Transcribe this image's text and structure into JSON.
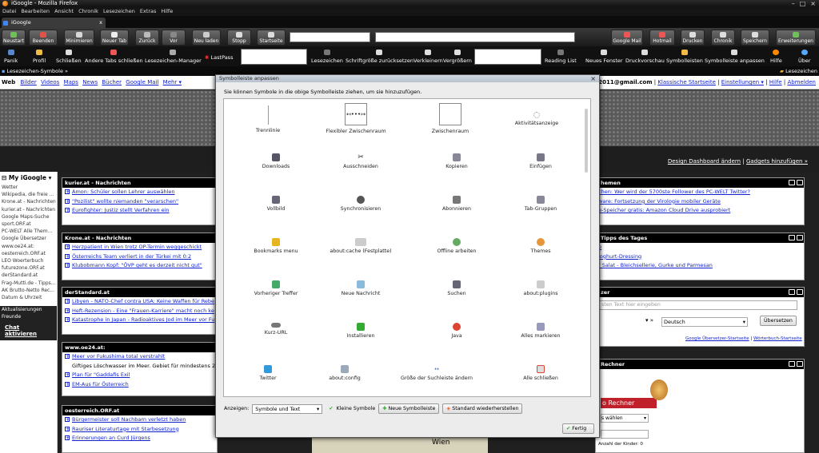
{
  "window": {
    "title": "iGoogle - Mozilla Firefox"
  },
  "menubar": [
    "Datei",
    "Bearbeiten",
    "Ansicht",
    "Chronik",
    "Lesezeichen",
    "Extras",
    "Hilfe"
  ],
  "tab": {
    "label": "iGoogle",
    "close": "x"
  },
  "toolbar": {
    "buttons": [
      "Neustart",
      "Beenden",
      "Minimieren",
      "Neuer Tab",
      "Zurück",
      "Vor",
      "Neu laden",
      "Stopp",
      "Startseite"
    ],
    "right_buttons": [
      "Google Mail",
      "Hotmail",
      "Drucken",
      "Chronik",
      "Speichern",
      "Erweiterungen"
    ]
  },
  "bookmarks": {
    "left": [
      "Panik",
      "Profil",
      "Schließen",
      "Andere Tabs schließen",
      "Lesezeichen-Manager"
    ],
    "lastpass": "LastPass",
    "middle": [
      "Lesezeichen",
      "Schriftgröße zurücksetzen",
      "Verkleinern",
      "Vergrößern"
    ],
    "right": [
      "Reading List",
      "Neues Fenster",
      "Druckvorschau",
      "Symbolleisten",
      "Symbolleiste anpassen",
      "Hilfe",
      "Über"
    ]
  },
  "lesezeichen_bar": {
    "label": "Lesezeichen-Symbole",
    "chevron": "»",
    "right": "Lesezeichen"
  },
  "google_nav": {
    "web": "Web",
    "links": [
      "Bilder",
      "Videos",
      "Maps",
      "News",
      "Bücher",
      "Google Mail",
      "Mehr ▾"
    ],
    "email": "rd.2011@gmail.com",
    "right_links": [
      "Klassische Startseite",
      "Einstellungen ▾",
      "Hilfe",
      "Abmelden"
    ]
  },
  "design_links": [
    "Design Dashboard ändern",
    "Gadgets hinzufügen »"
  ],
  "sidebar": {
    "title": "My iGoogle",
    "items": [
      "Wetter",
      "Wikipedia, die freie ...",
      "Krone.at - Nachrichten",
      "kurier.at - Nachrichten",
      "Google Maps-Suche",
      "sport.ORF.at",
      "PC-WELT Alle Them...",
      "Google Übersetzer",
      "www.oe24.at:",
      "oesterreich.ORF.at",
      "LEO Woerterbuch",
      "futurezone.ORF.at",
      "derStandard.at",
      "Frag-Mutti.de - Tipps...",
      "AK Brutto-Netto Rec...",
      "Datum & Uhrzeit"
    ],
    "extra": [
      "Aktualisierungen",
      "Freunde"
    ],
    "activate": "Chat aktivieren"
  },
  "gadgets_left": [
    {
      "title": "kurier.at - Nachrichten",
      "items": [
        "Amon: Schüler sollen Lehrer auswählen",
        "\"Pozilist\" wollte niemanden \"verarschen\"",
        "Eurofighter: Justiz stellt Verfahren ein"
      ]
    },
    {
      "title": "Krone.at - Nachrichten",
      "items": [
        "Herzpatient in Wien trotz OP-Termin weggeschickt",
        "Österreichs Team verliert in der Türkei mit 0:2",
        "Klubobmann Kopf: \"ÖVP geht es derzeit nicht gut\""
      ]
    },
    {
      "title": "derStandard.at",
      "items": [
        "Libyen - NATO-Chef contra USA: Keine Waffen für Rebe",
        "Heft-Rezension - Eine \"Frauen-Karriere\" macht noch ke",
        "Katastrophe in Japan - Radioaktives Jod im Meer vor Fu"
      ]
    },
    {
      "title": "www.oe24.at:",
      "items": [
        "Meer vor Fukushima total verstrahlt",
        "Giftiges Löschwasser im Meer. Gebiet für mindestens 2",
        "Plan für \"Gaddafis Exil",
        "EM-Aus für Österreich"
      ]
    },
    {
      "title": "oesterreich.ORF.at",
      "items": [
        "Bürgermeister soll Nachbarn verletzt haben",
        "Rauriser Literaturtage mit Starbesetzung",
        "Erinnerungen an Curd Jürgens"
      ]
    }
  ],
  "gadgets_right": [
    {
      "title": "hemen",
      "items": [
        "chen: Wer wird der 5700ste Follower des PC-WELT Twitter?",
        "ware: Fortsetzung der Virologie mobiler Geräte",
        "e-Speicher gratis: Amazon Cloud Drive ausprobiert"
      ]
    },
    {
      "title": "Tipps des Tages",
      "items": [
        "p",
        "Joghurt-Dressing",
        "r Salat - Bleichsellerie, Gurke und Parmesan"
      ]
    },
    {
      "title": "zer",
      "items": [
        "sten Text hier eingeben"
      ],
      "lang": "Deutsch",
      "button": "Übersetzen",
      "links": [
        "Google Übersetzer-Startseite",
        "Wörterbuch-Startseite"
      ]
    },
    {
      "title": "Rechner",
      "items": [
        "o Rechner",
        "s wählen",
        "Anzahl der Kinder: 0"
      ]
    }
  ],
  "map": {
    "label": "Wien"
  },
  "dialog": {
    "title": "Symbolleiste anpassen",
    "close": "×",
    "info": "Sie können Symbole in die obige Symbolleiste ziehen, um sie hinzuzufügen.",
    "items": [
      [
        "Trennlinie",
        "Flexibler Zwischenraum",
        "Zwischenraum",
        "Aktivitätsanzeige"
      ],
      [
        "Downloads",
        "Ausschneiden",
        "Kopieren",
        "Einfügen"
      ],
      [
        "Vollbild",
        "Synchronisieren",
        "Abonnieren",
        "Tab-Gruppen"
      ],
      [
        "Bookmarks menu",
        "about:cache (Festplatte)",
        "Offline arbeiten",
        "Themes"
      ],
      [
        "Vorheriger Treffer",
        "Neue Nachricht",
        "Suchen",
        "about:plugins"
      ],
      [
        "Kurz-URL",
        "Installieren",
        "Java",
        "Alles markieren"
      ],
      [
        "Twitter",
        "about:config",
        "Größe der Suchleiste ändern",
        "Alle schließen"
      ]
    ],
    "show_label": "Anzeigen:",
    "show_value": "Symbole und Text",
    "small_icons": "Kleine Symbole",
    "new_toolbar": "Neue Symbolleiste",
    "restore": "Standard wiederherstellen",
    "done": "Fertig"
  },
  "colors": {
    "accent_blue": "#1122cc",
    "toolbar_dark": "#1a1a1a",
    "gadget_header": "#000000"
  }
}
